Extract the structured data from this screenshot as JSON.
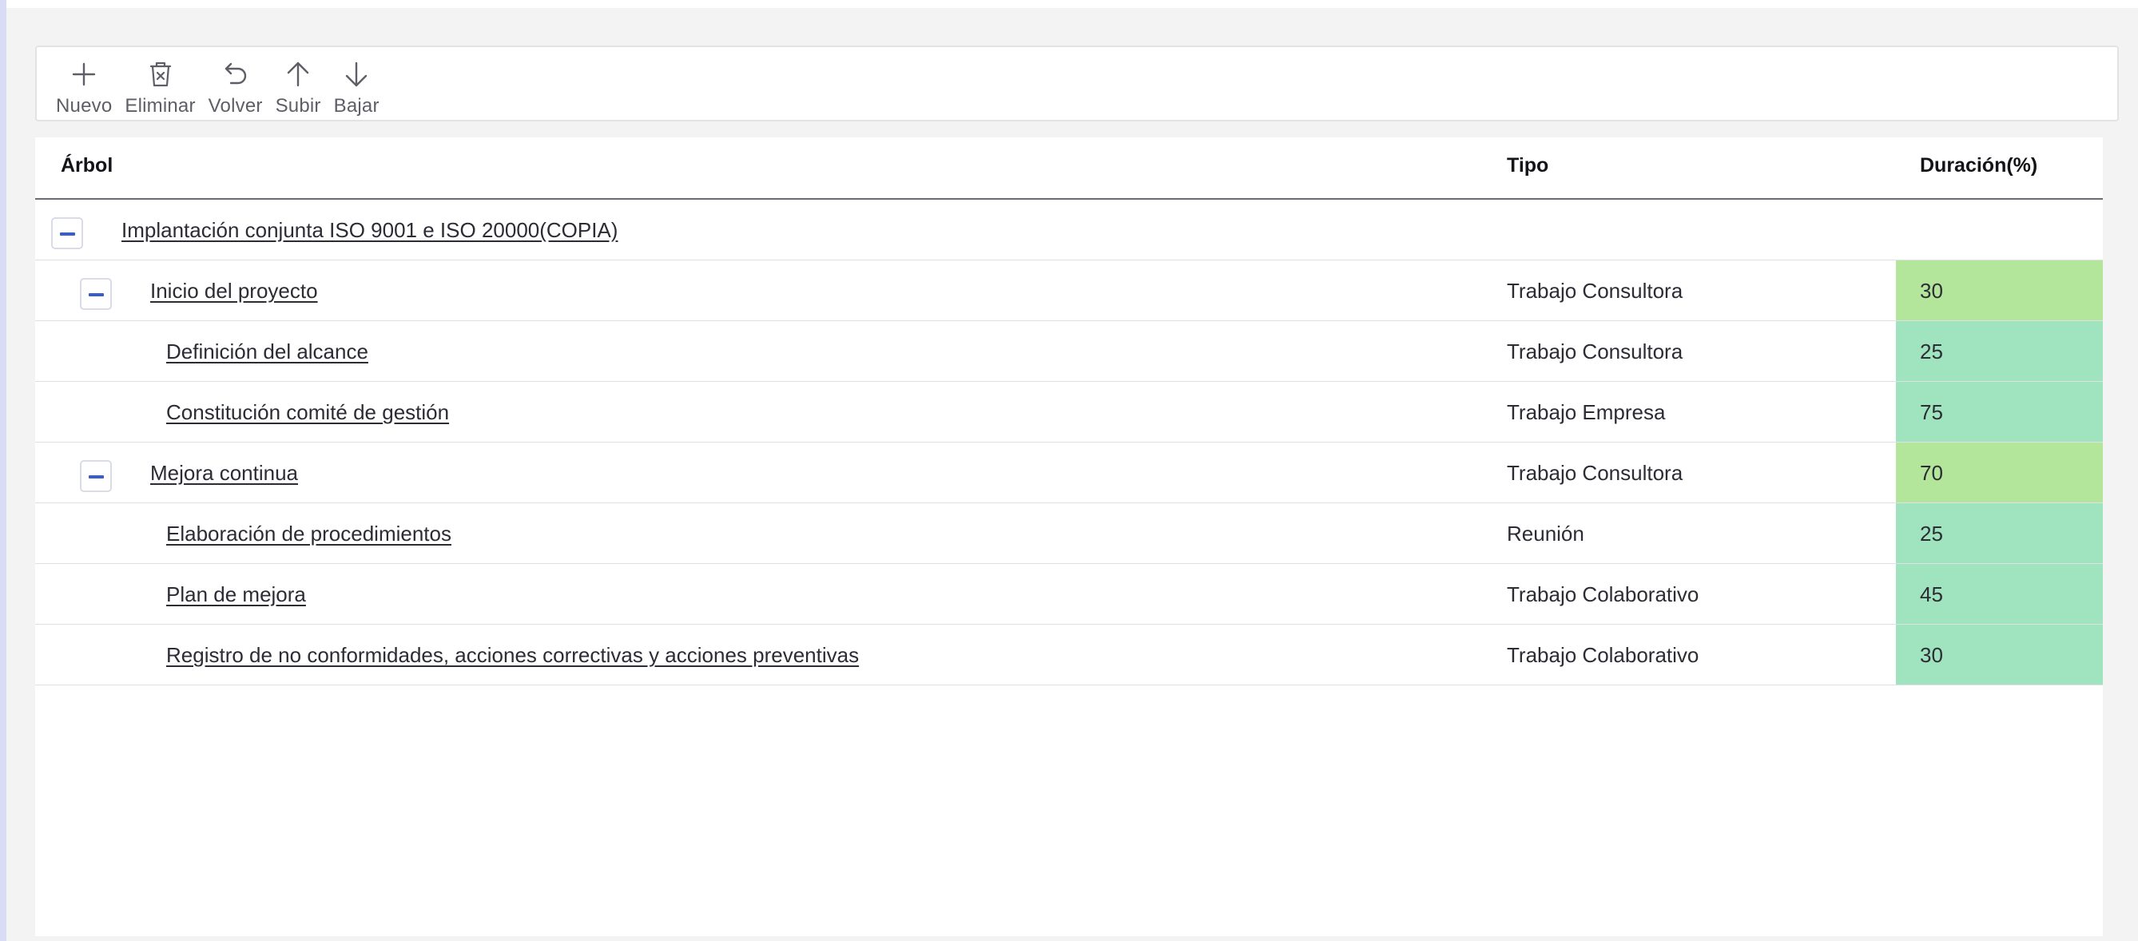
{
  "toolbar": {
    "buttons": [
      {
        "label": "Nuevo",
        "icon": "plus-icon"
      },
      {
        "label": "Eliminar",
        "icon": "trash-icon"
      },
      {
        "label": "Volver",
        "icon": "undo-icon"
      },
      {
        "label": "Subir",
        "icon": "arrow-up-icon"
      },
      {
        "label": "Bajar",
        "icon": "arrow-down-icon"
      }
    ]
  },
  "table": {
    "columns": {
      "arbol": "Árbol",
      "tipo": "Tipo",
      "duracion": "Duración(%)"
    },
    "rows": [
      {
        "name": "Implantación conjunta ISO 9001 e ISO 20000(COPIA)",
        "tipo": "",
        "duracion": "",
        "level": 0,
        "expanded": true
      },
      {
        "name": "Inicio del proyecto",
        "tipo": "Trabajo Consultora",
        "duracion": "30",
        "level": 1,
        "expanded": true,
        "color": "#b3e59a"
      },
      {
        "name": "Definición del alcance",
        "tipo": "Trabajo Consultora",
        "duracion": "25",
        "level": 2,
        "color": "#a0e4bf"
      },
      {
        "name": "Constitución comité de gestión",
        "tipo": "Trabajo Empresa",
        "duracion": "75",
        "level": 2,
        "color": "#a0e4bf"
      },
      {
        "name": "Mejora continua",
        "tipo": "Trabajo Consultora",
        "duracion": "70",
        "level": 1,
        "expanded": true,
        "color": "#b3e59a"
      },
      {
        "name": "Elaboración de procedimientos",
        "tipo": "Reunión",
        "duracion": "25",
        "level": 2,
        "color": "#a0e4bf"
      },
      {
        "name": "Plan de mejora",
        "tipo": "Trabajo Colaborativo",
        "duracion": "45",
        "level": 2,
        "color": "#a0e4bf"
      },
      {
        "name": "Registro de no conformidades, acciones correctivas y acciones preventivas",
        "tipo": "Trabajo Colaborativo",
        "duracion": "30",
        "level": 2,
        "color": "#a0e4bf"
      }
    ]
  }
}
